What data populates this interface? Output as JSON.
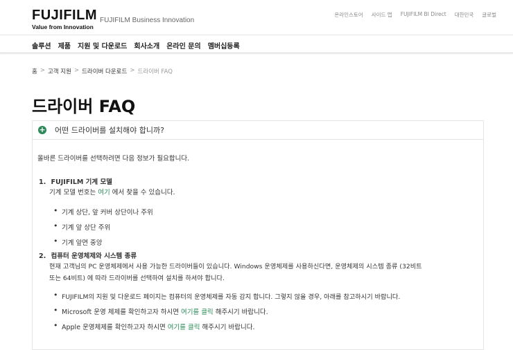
{
  "header": {
    "brand": "FUJIFILM",
    "tagline": "Value from Innovation",
    "subbrand": "FUJIFILM Business Innovation",
    "util_links": [
      "온라인스토어",
      "사이드 맵",
      "FUJIFILM BI Direct",
      "대한민국",
      "글로벌"
    ]
  },
  "nav": {
    "items": [
      "솔루션",
      "제품",
      "지원 및 다운로드",
      "회사소개",
      "온라인 문의",
      "멤버십등록"
    ]
  },
  "breadcrumb": [
    "홈",
    "고객 지원",
    "드라이버 다운로드",
    "드라이버 FAQ"
  ],
  "page_title": "드라이버 FAQ",
  "accordion": {
    "title": "어떤 드라이버를 설치해야 합니까?",
    "intro": "올바른 드라이버를 선택하려면 다음 정보가 필요합니다.",
    "step1": {
      "num": "1.",
      "title": "FUJIFILM 기계 모델",
      "desc_a": "기계 모델 번호는 ",
      "desc_link": "여기",
      "desc_b": " 에서 찾을 수 있습니다.",
      "bullets": [
        "기계 상단, 앞 커버 상단이나 주위",
        "기계 앞 상단 주위",
        "기계 앞면 중앙"
      ]
    },
    "step2": {
      "num": "2.",
      "title": "컴퓨터 운영체제와 시스템 종류",
      "desc_line1": "현재 고객님의 PC 운영체제에서 사용 가능한 드라이버들이 있습니다. Windows 운영체제를 사용하신다면, 운영체제의 시스템 종류 (32비트",
      "desc_line2": "또는 64비트) 에 따라 드라이버를 선택하여 설치를 하셔야 합니다.",
      "bullet1": "FUJIFILM의 지원 및 다운로드 페이지는 컴퓨터의 운영체제를 자동 감지 합니다. 그렇지 않을 경우, 아래를 참고하시기 바랍니다.",
      "bullet2_a": "Microsoft 운영 체제를 확인하고자 하시면 ",
      "bullet2_link": "여기를 클릭",
      "bullet2_b": " 해주시기 바랍니다.",
      "bullet3_a": "Apple 운영체제를 확인하고자 하시면 ",
      "bullet3_link": "여기를 클릭",
      "bullet3_b": " 해주시기 바랍니다."
    }
  }
}
